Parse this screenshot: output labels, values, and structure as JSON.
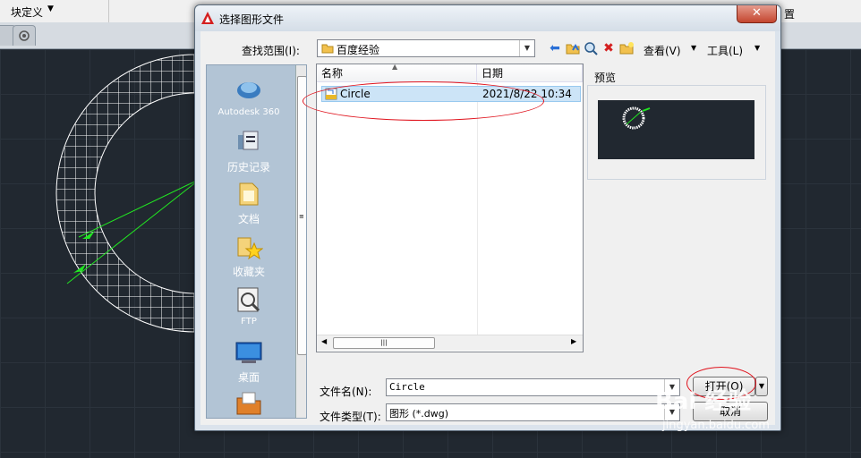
{
  "background": {
    "block_define_label": "块定义",
    "settings_label": "置"
  },
  "dialog": {
    "title": "选择图形文件",
    "close_glyph": "✕",
    "look_in_label": "查找范围(I):",
    "look_in_value": "百度经验",
    "view_label": "查看(V)",
    "tools_label": "工具(L)",
    "places": [
      {
        "label": "Autodesk 360",
        "icon": "cloud-icon"
      },
      {
        "label": "历史记录",
        "icon": "history-icon"
      },
      {
        "label": "文档",
        "icon": "documents-icon"
      },
      {
        "label": "收藏夹",
        "icon": "favorites-icon"
      },
      {
        "label": "FTP",
        "icon": "ftp-icon"
      },
      {
        "label": "桌面",
        "icon": "desktop-icon"
      }
    ],
    "columns": {
      "name": "名称",
      "date": "日期"
    },
    "files": [
      {
        "name": "Circle",
        "date": "2021/8/22 10:34",
        "icon": "dwg-file-icon"
      }
    ],
    "preview_label": "预览",
    "filename_label": "文件名(N):",
    "filename_value": "Circle",
    "filetype_label": "文件类型(T):",
    "filetype_value": "图形 (*.dwg)",
    "open_button": "打开(O)",
    "cancel_button": "取消",
    "scroll_grip": "|||"
  },
  "watermark": {
    "brand": "Bai 经验",
    "url": "jingyan.baidu.com"
  },
  "colors": {
    "accent": "#e0141e",
    "grid": "#2b333c",
    "selection": "#cce4f7"
  }
}
